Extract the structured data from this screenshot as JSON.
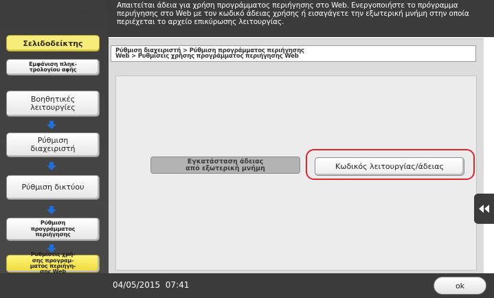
{
  "header": {
    "message": "Απαιτείται άδεια για χρήση προγράμματος περιήγησης στο Web. Ενεργοποιήστε το πρόγραμμα περιήγησης στο Web με τον κωδικό άδειας χρήσης ή εισαγάγετε την εξωτερική μνήμη στην οποία περιέχεται το αρχείο επικύρωσης λειτουργίας."
  },
  "sidebar": {
    "bookmark_label": "Σελιδοδείκτης",
    "display_label": "Εμφάνιση πληκ-\nτρολογίου αφής",
    "steps": [
      "Βοηθητικές\nλειτουργίες",
      "Ρύθμιση\nδιαχειριστή",
      "Ρύθμιση δικτύου",
      "Ρύθμιση\nπρογράμματος\nπεριήγησης",
      "Ρυθμίσεις χρή-\nσης προγραμ-\nματος περιήγη-\nσης Web"
    ]
  },
  "breadcrumb": {
    "text": "Ρύθμιση διαχειριστή > Ρύθμιση προγράμματος περιήγησης\nWeb > Ρυθμίσεις χρήσης προγράμματος περιήγησης Web"
  },
  "buttons": {
    "install_cert": "Εγκατάσταση άδειας\nαπό εξωτερική μνήμη",
    "function_code": "Κωδικός λειτουργίας/άδειας",
    "ok": "ok"
  },
  "footer": {
    "datetime": "04/05/2015  07:41"
  },
  "colors": {
    "highlight": "#e0242b",
    "active_step": "#f3e14e",
    "arrow": "#1f6fd6"
  },
  "icons": {
    "step_arrow": "arrow-down-icon",
    "side_tab": "double-chevron-left-icon"
  }
}
